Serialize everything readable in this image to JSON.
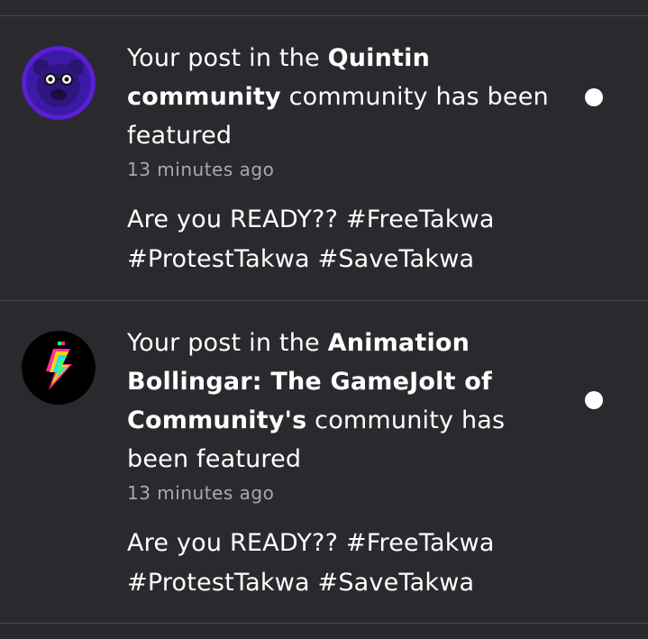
{
  "notifications": [
    {
      "prefix": "Your post in the ",
      "community": "Quintin community",
      "suffix": " community has been featured",
      "time": "13 minutes ago",
      "post_text": "Are you READY?? #FreeTakwa #ProtestTakwa #SaveTakwa",
      "unread": true
    },
    {
      "prefix": "Your post in the ",
      "community": "Animation Bollingar: The GameJolt of Community's",
      "suffix": " community has been featured",
      "time": "13 minutes ago",
      "post_text": "Are you READY?? #FreeTakwa #ProtestTakwa #SaveTakwa",
      "unread": true
    }
  ],
  "colors": {
    "background": "#2a2a2e",
    "divider": "#46464b",
    "timestamp": "#a9a9ad",
    "unread_dot": "#ffffff"
  }
}
